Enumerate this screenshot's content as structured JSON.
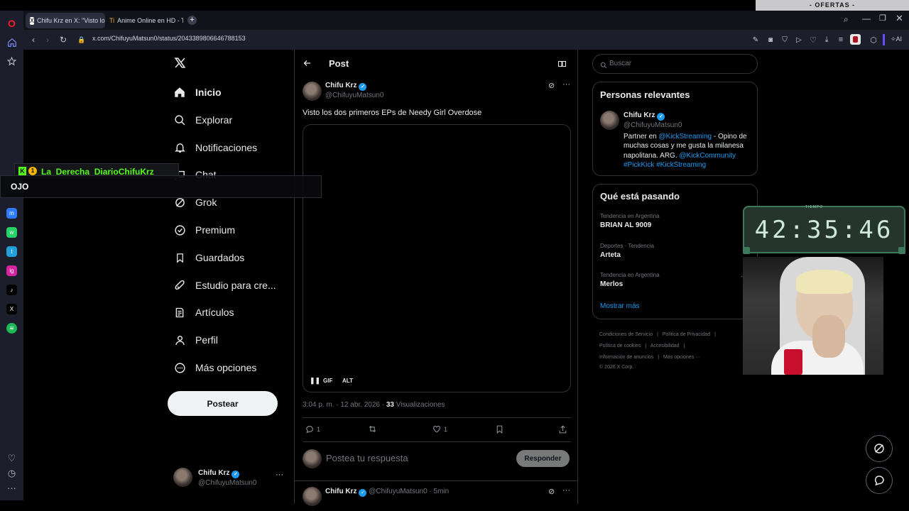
{
  "browser": {
    "tabs": [
      {
        "label": "Chifu Krz en X: \"Visto los",
        "favicon": "x-logo-icon"
      },
      {
        "label": "Anime Online en HD - Tio",
        "favicon": "tio-anime-icon"
      }
    ],
    "url": "x.com/ChifuyuMatsun0/status/2043389806646788153",
    "ofertas": "- OFERTAS -",
    "ai_label": "AI"
  },
  "sidebar": {
    "items": [
      {
        "label": "Inicio",
        "icon": "home-icon"
      },
      {
        "label": "Explorar",
        "icon": "search-icon"
      },
      {
        "label": "Notificaciones",
        "icon": "bell-icon"
      },
      {
        "label": "Chat",
        "icon": "chat-icon"
      },
      {
        "label": "Grok",
        "icon": "grok-icon"
      },
      {
        "label": "Premium",
        "icon": "premium-icon"
      },
      {
        "label": "Guardados",
        "icon": "bookmark-icon"
      },
      {
        "label": "Estudio para cre...",
        "icon": "rocket-icon"
      },
      {
        "label": "Artículos",
        "icon": "article-icon"
      },
      {
        "label": "Perfil",
        "icon": "person-icon"
      },
      {
        "label": "Más opciones",
        "icon": "more-circle-icon"
      }
    ],
    "post_button": "Postear",
    "account": {
      "name": "Chifu Krz",
      "handle": "@ChifuyuMatsun0"
    }
  },
  "post": {
    "header": "Post",
    "author": {
      "name": "Chifu Krz",
      "handle": "@ChifuyuMatsun0"
    },
    "text": "Visto los dos primeros EPs de Needy Girl Overdose",
    "media_controls": {
      "gif": "GIF",
      "alt": "ALT"
    },
    "meta": {
      "time": "3:04 p. m. · 12 abr. 2026 · ",
      "views_count": "33",
      "views_label": " Visualizaciones"
    },
    "actions": {
      "replies": "1",
      "likes": "1"
    },
    "reply": {
      "placeholder": "Postea tu respuesta",
      "button": "Responder"
    },
    "next_reply": {
      "name": "Chifu Krz",
      "handle": "@ChifuyuMatsun0",
      "time": "· 5min"
    }
  },
  "right": {
    "search_placeholder": "Buscar",
    "relevant": {
      "title": "Personas relevantes",
      "name": "Chifu Krz",
      "handle": "@ChifuyuMatsun0",
      "bio_1": "Partner en ",
      "bio_link1": "@KickStreaming",
      "bio_2": " - Opino de muchas cosas y me gusta la milanesa napolitana. ARG. ",
      "bio_link2": "@KickCommunity",
      "bio_tags": "#PickKick #KickStreaming"
    },
    "trends": {
      "title": "Qué está pasando",
      "items": [
        {
          "context": "Tendencia en Argentina",
          "name": "BRIAN AL 9009"
        },
        {
          "context": "Deportes · Tendencia",
          "name": "Arteta"
        },
        {
          "context": "Tendencia en Argentina",
          "name": "Merlos"
        }
      ],
      "show_more": "Mostrar más"
    },
    "footer": {
      "terms": "Condiciones de Servicio",
      "privacy": "Política de Privacidad",
      "cookies": "Política de cookies",
      "accessibility": "Accesibilidad",
      "ads": "Información de anuncios",
      "more": "Más opciones ···",
      "copyright": "© 2026 X Corp."
    }
  },
  "overlay": {
    "chat_user": "La_Derecha_DiarioChifuKrz",
    "chat_message": "OJO",
    "timer": "42:35:46",
    "timer_label": "TIEMPO"
  },
  "colors": {
    "accent": "#1d9bf0",
    "kick": "#53fc18",
    "timer_text": "#cfe8da",
    "timer_bg": "#26342e"
  }
}
